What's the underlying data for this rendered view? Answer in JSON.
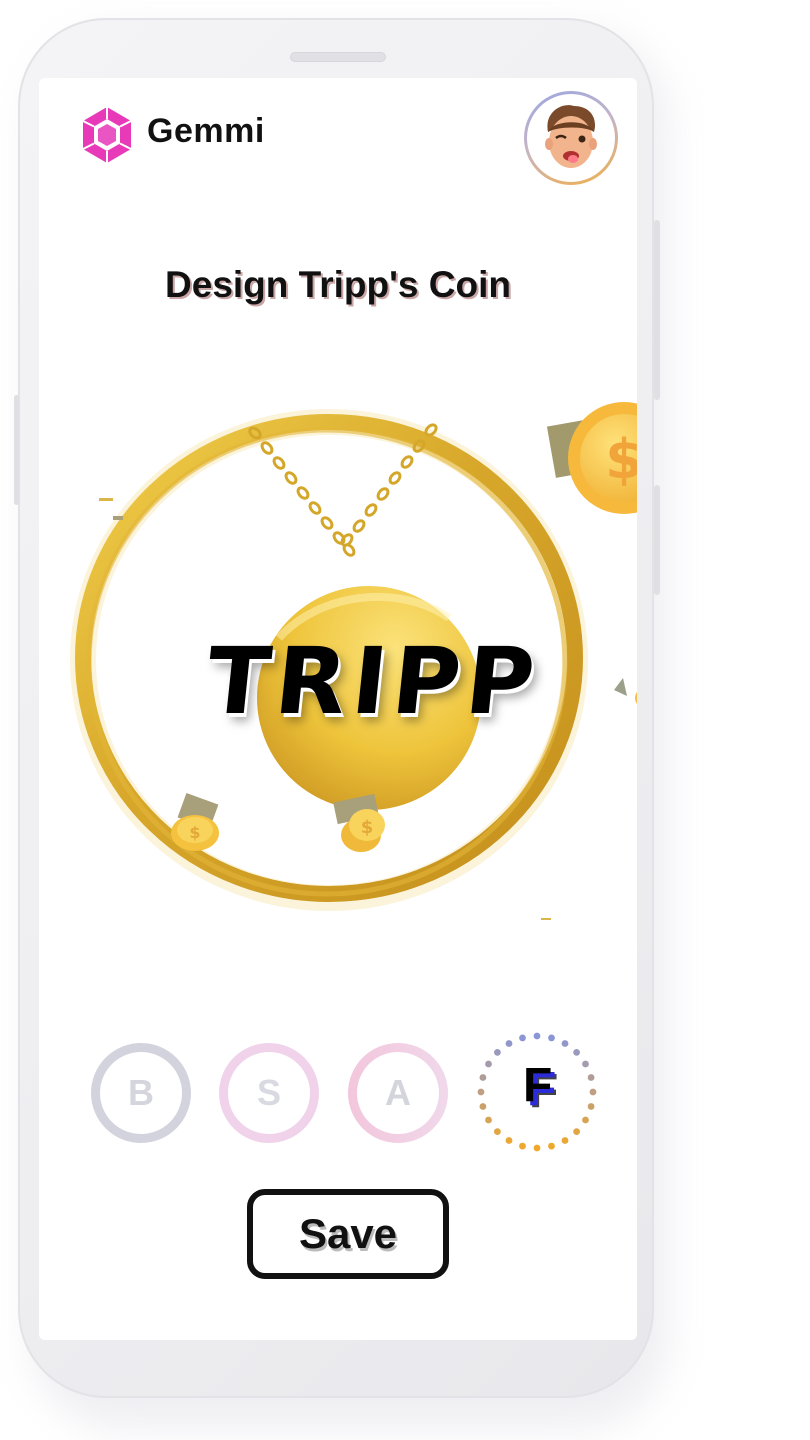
{
  "header": {
    "brand_name": "Gemmi",
    "logo_icon": "gem-hexagon-icon",
    "avatar_icon": "memoji-avatar"
  },
  "main": {
    "title": "Design Tripp's Coin",
    "coin_text": "TRIPP",
    "tiers": [
      {
        "label": "B",
        "selected": false
      },
      {
        "label": "S",
        "selected": false
      },
      {
        "label": "A",
        "selected": false
      },
      {
        "label": "F",
        "selected": true
      }
    ],
    "save_label": "Save"
  },
  "colors": {
    "gold": "#e6b92e",
    "logo_pink": "#e83ab8",
    "text": "#111111"
  }
}
